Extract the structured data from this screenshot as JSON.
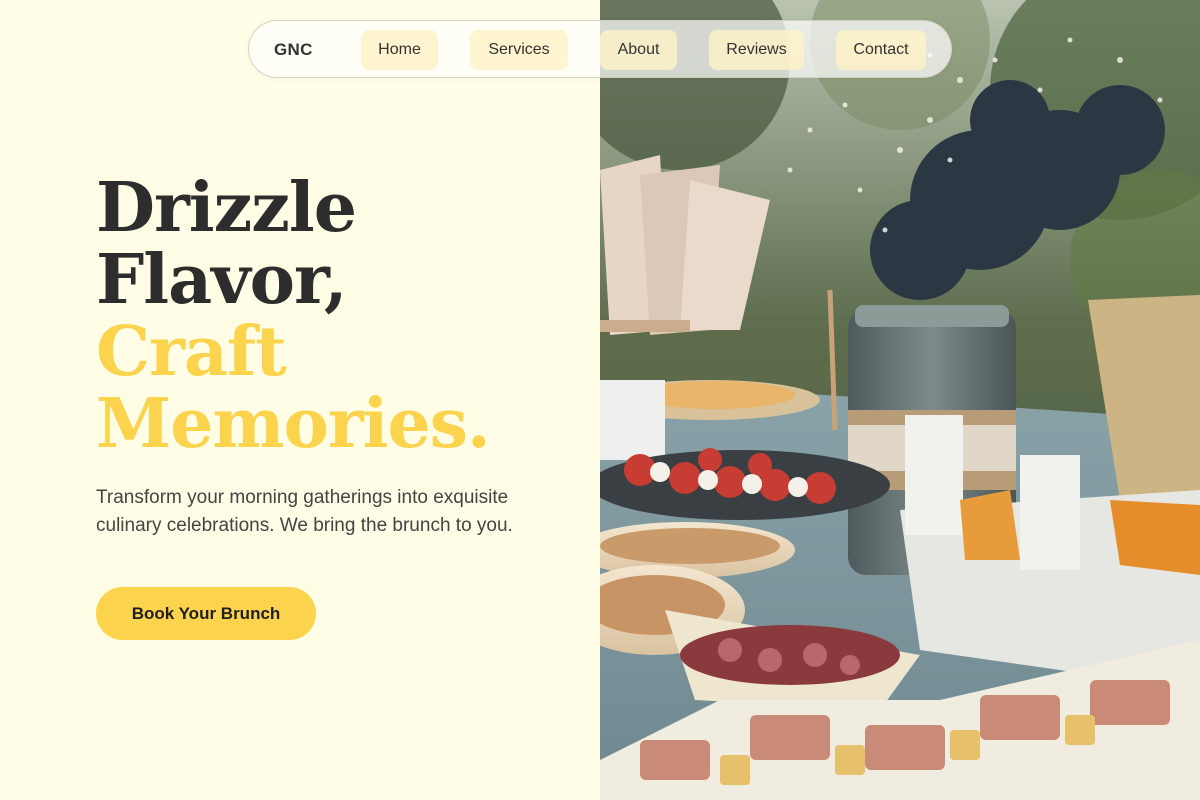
{
  "nav": {
    "brand": "GNC",
    "links": [
      "Home",
      "Services",
      "About",
      "Reviews",
      "Contact"
    ]
  },
  "hero": {
    "line1": "Drizzle",
    "line2": "Flavor,",
    "line3": "Craft",
    "line4": "Memories.",
    "subtitle": "Transform your morning gatherings into exquisite culinary celebrations. We bring the brunch to you.",
    "cta_label": "Book Your Brunch"
  },
  "colors": {
    "background": "#fffde6",
    "accent": "#fcd34d",
    "text_dark": "#2d2d2d",
    "nav_pill": "#fef3c7"
  },
  "image": {
    "alt": "Outdoor brunch table with floral jar centerpiece, snacks and sandwiches"
  }
}
